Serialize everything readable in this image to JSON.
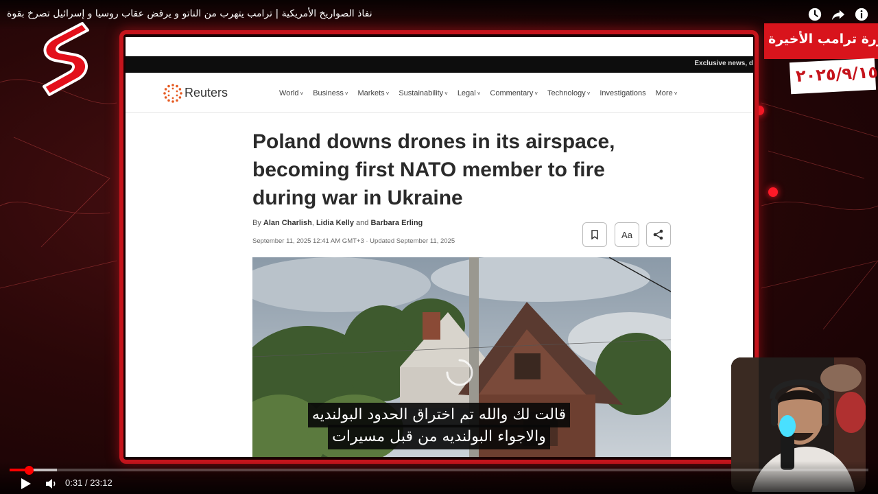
{
  "video": {
    "title": "نفاذ الصواريخ الأمريكية | ترامب يتهرب من الناتو و يرفض عقاب روسيا و إسرائيل تصرخ بقوة",
    "current_time": "0:31",
    "separator": "/",
    "duration": "23:12",
    "progress_fraction": 0.0223,
    "buffer_fraction": 0.055
  },
  "article": {
    "exclusive_strip": "Exclusive news, d",
    "brand": "Reuters",
    "nav": [
      "World",
      "Business",
      "Markets",
      "Sustainability",
      "Legal",
      "Commentary",
      "Technology",
      "Investigations",
      "More"
    ],
    "nav_dropdown": [
      true,
      true,
      true,
      true,
      true,
      true,
      true,
      false,
      true
    ],
    "headline": "Poland downs drones in its airspace, becoming first NATO member to fire during war in Ukraine",
    "byline_prefix": "By",
    "author1": "Alan Charlish",
    "author2": "Lidia Kelly",
    "and": "and",
    "author3": "Barbara Erling",
    "dateline": "September 11, 2025 12:41 AM GMT+3 · Updated September 11, 2025",
    "textsize_label": "Aa"
  },
  "badge": {
    "title": "مجزرة ترامب الأخيرة",
    "date": "٢٠٢٥/٩/١٥"
  },
  "subtitles": {
    "line1": "قالت لك والله تم اختراق الحدود البولنديه",
    "line2": "والاجواء البولنديه من قبل مسيرات"
  },
  "icons": {
    "watch_later": "clock-icon",
    "share": "share-arrow-icon",
    "info": "info-icon",
    "play": "play-icon",
    "volume": "volume-icon",
    "bookmark": "bookmark-icon",
    "article_share": "share-nodes-icon"
  },
  "colors": {
    "accent_red": "#c5141c",
    "progress_red": "#ff0000",
    "reuters_orange": "#e65a21"
  }
}
